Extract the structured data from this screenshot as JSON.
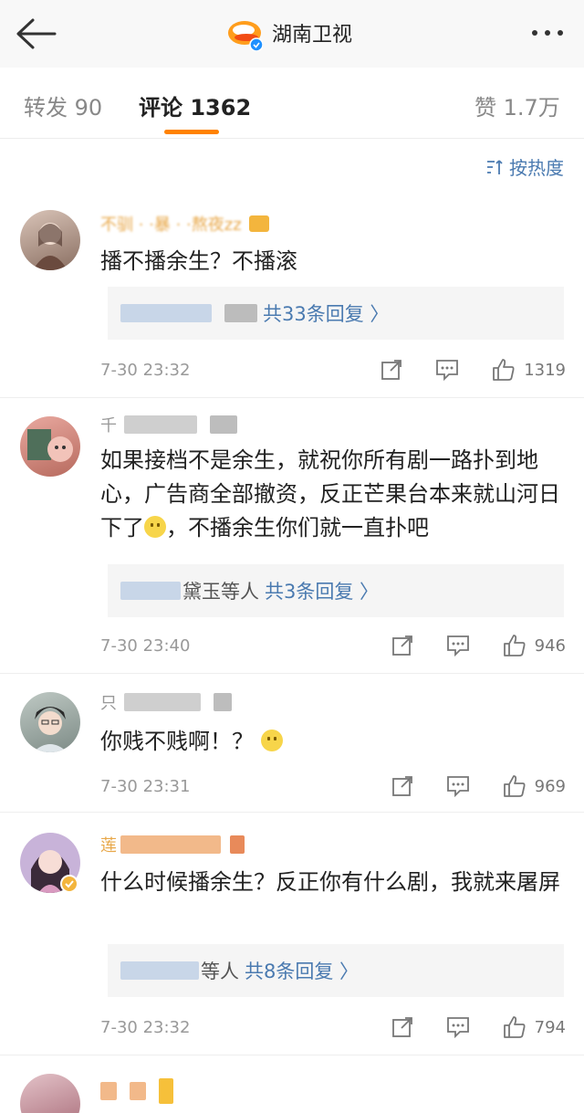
{
  "header": {
    "title": "湖南卫视",
    "back_icon": "back-arrow-icon",
    "more_icon": "more-dots-icon"
  },
  "tabs": {
    "repost": "转发 90",
    "comments": "评论 1362",
    "likes": "赞 1.7万"
  },
  "sort": {
    "label": "按热度",
    "icon": "sort-icon"
  },
  "colors": {
    "accent": "#ff8200",
    "link": "#4a7ab0",
    "name": "#e8a84a"
  },
  "comments": [
    {
      "username": "不驯 ·  ·暴 ·  ·熬夜zz",
      "text": "播不播余生？不播滚",
      "reply": {
        "users": "",
        "link": "共33条回复 〉"
      },
      "time": "7-30 23:32",
      "likes": "1319"
    },
    {
      "username": "千",
      "text": "如果接档不是余生，就祝你所有剧一路扑到地心，广告商全部撤资，反正芒果台本来就山河日下了",
      "text_tail": "，不播余生你们就一直扑吧",
      "reply": {
        "users": "黛玉等人",
        "link": "共3条回复 〉"
      },
      "time": "7-30 23:40",
      "likes": "946"
    },
    {
      "username": "只",
      "text": "你贱不贱啊！？",
      "time": "7-30 23:31",
      "likes": "969"
    },
    {
      "username": "莲",
      "text": "什么时候播余生？反正你有什么剧，我就来屠屏",
      "reply": {
        "users": "等人",
        "link": "共8条回复 〉"
      },
      "time": "7-30 23:32",
      "likes": "794"
    }
  ]
}
